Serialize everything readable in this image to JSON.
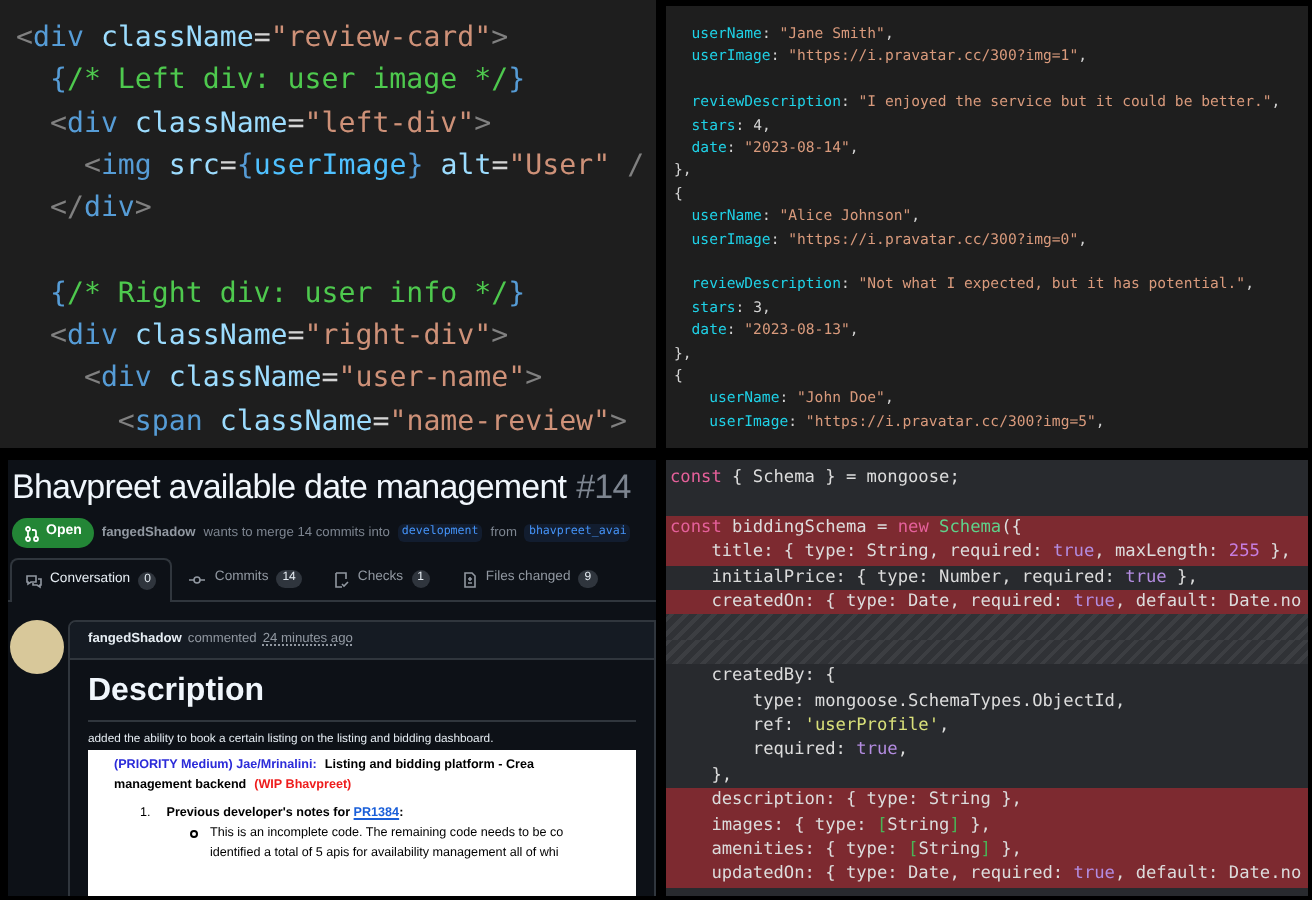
{
  "jsx_snippet": {
    "lines": [
      {
        "kind": "code",
        "tokens": [
          {
            "kind": "punct",
            "text": "<"
          },
          {
            "kind": "tag",
            "text": "div"
          },
          {
            "kind": "attr",
            "text": " className"
          },
          {
            "kind": "op",
            "text": "="
          },
          {
            "kind": "str",
            "text": "\"review-card\""
          },
          {
            "kind": "punct",
            "text": ">"
          }
        ]
      },
      {
        "kind": "code",
        "tokens": [
          {
            "kind": "brace",
            "text": "  {"
          },
          {
            "kind": "comment",
            "text": "/* Left div: user image */"
          },
          {
            "kind": "brace",
            "text": "}"
          }
        ]
      },
      {
        "kind": "code",
        "tokens": [
          {
            "kind": "punct",
            "text": "  <"
          },
          {
            "kind": "tag",
            "text": "div"
          },
          {
            "kind": "attr",
            "text": " className"
          },
          {
            "kind": "op",
            "text": "="
          },
          {
            "kind": "str",
            "text": "\"left-div\""
          },
          {
            "kind": "punct",
            "text": ">"
          }
        ]
      },
      {
        "kind": "code",
        "tokens": [
          {
            "kind": "punct",
            "text": "    <"
          },
          {
            "kind": "tag",
            "text": "img"
          },
          {
            "kind": "attr",
            "text": " src"
          },
          {
            "kind": "op",
            "text": "="
          },
          {
            "kind": "brace",
            "text": "{"
          },
          {
            "kind": "var",
            "text": "userImage"
          },
          {
            "kind": "brace",
            "text": "}"
          },
          {
            "kind": "attr",
            "text": " alt"
          },
          {
            "kind": "op",
            "text": "="
          },
          {
            "kind": "str",
            "text": "\"User\""
          },
          {
            "kind": "punct",
            "text": " /"
          }
        ]
      },
      {
        "kind": "code",
        "tokens": [
          {
            "kind": "punct",
            "text": "  </"
          },
          {
            "kind": "tag",
            "text": "div"
          },
          {
            "kind": "punct",
            "text": ">"
          }
        ]
      },
      {
        "kind": "blank"
      },
      {
        "kind": "code",
        "tokens": [
          {
            "kind": "brace",
            "text": "  {"
          },
          {
            "kind": "comment",
            "text": "/* Right div: user info */"
          },
          {
            "kind": "brace",
            "text": "}"
          }
        ]
      },
      {
        "kind": "code",
        "tokens": [
          {
            "kind": "punct",
            "text": "  <"
          },
          {
            "kind": "tag",
            "text": "div"
          },
          {
            "kind": "attr",
            "text": " className"
          },
          {
            "kind": "op",
            "text": "="
          },
          {
            "kind": "str",
            "text": "\"right-div\""
          },
          {
            "kind": "punct",
            "text": ">"
          }
        ]
      },
      {
        "kind": "code",
        "tokens": [
          {
            "kind": "punct",
            "text": "    <"
          },
          {
            "kind": "tag",
            "text": "div"
          },
          {
            "kind": "attr",
            "text": " className"
          },
          {
            "kind": "op",
            "text": "="
          },
          {
            "kind": "str",
            "text": "\"user-name\""
          },
          {
            "kind": "punct",
            "text": ">"
          }
        ]
      },
      {
        "kind": "code",
        "tokens": [
          {
            "kind": "punct",
            "text": "      <"
          },
          {
            "kind": "tag",
            "text": "span"
          },
          {
            "kind": "attr",
            "text": " className"
          },
          {
            "kind": "op",
            "text": "="
          },
          {
            "kind": "str",
            "text": "\"name-review\""
          },
          {
            "kind": "punct",
            "text": ">"
          }
        ]
      }
    ]
  },
  "reviews_data": {
    "lines": [
      {
        "kind": "code",
        "tokens": [
          {
            "kind": "key",
            "text": "  userName"
          },
          {
            "kind": "punct",
            "text": ": "
          },
          {
            "kind": "str",
            "text": "\"Jane Smith\""
          },
          {
            "kind": "punct",
            "text": ","
          }
        ]
      },
      {
        "kind": "code",
        "tokens": [
          {
            "kind": "key",
            "text": "  userImage"
          },
          {
            "kind": "punct",
            "text": ": "
          },
          {
            "kind": "str",
            "text": "\"https://i.pravatar.cc/300?img=1\""
          },
          {
            "kind": "punct",
            "text": ","
          }
        ]
      },
      {
        "kind": "blank"
      },
      {
        "kind": "code",
        "tokens": [
          {
            "kind": "key",
            "text": "  reviewDescription"
          },
          {
            "kind": "punct",
            "text": ": "
          },
          {
            "kind": "str",
            "text": "\"I enjoyed the service but it could be better.\""
          },
          {
            "kind": "punct",
            "text": ","
          }
        ]
      },
      {
        "kind": "code",
        "tokens": [
          {
            "kind": "key",
            "text": "  stars"
          },
          {
            "kind": "punct",
            "text": ": "
          },
          {
            "kind": "num",
            "text": "4"
          },
          {
            "kind": "punct",
            "text": ","
          }
        ]
      },
      {
        "kind": "code",
        "tokens": [
          {
            "kind": "key",
            "text": "  date"
          },
          {
            "kind": "punct",
            "text": ": "
          },
          {
            "kind": "str",
            "text": "\"2023-08-14\""
          },
          {
            "kind": "punct",
            "text": ","
          }
        ]
      },
      {
        "kind": "code",
        "tokens": [
          {
            "kind": "punct",
            "text": "},"
          }
        ]
      },
      {
        "kind": "code",
        "tokens": [
          {
            "kind": "punct",
            "text": "{"
          }
        ]
      },
      {
        "kind": "code",
        "tokens": [
          {
            "kind": "key",
            "text": "  userName"
          },
          {
            "kind": "punct",
            "text": ": "
          },
          {
            "kind": "str",
            "text": "\"Alice Johnson\""
          },
          {
            "kind": "punct",
            "text": ","
          }
        ]
      },
      {
        "kind": "code",
        "tokens": [
          {
            "kind": "key",
            "text": "  userImage"
          },
          {
            "kind": "punct",
            "text": ": "
          },
          {
            "kind": "str",
            "text": "\"https://i.pravatar.cc/300?img=0\""
          },
          {
            "kind": "punct",
            "text": ","
          }
        ]
      },
      {
        "kind": "blank"
      },
      {
        "kind": "code",
        "tokens": [
          {
            "kind": "key",
            "text": "  reviewDescription"
          },
          {
            "kind": "punct",
            "text": ": "
          },
          {
            "kind": "str",
            "text": "\"Not what I expected, but it has potential.\""
          },
          {
            "kind": "punct",
            "text": ","
          }
        ]
      },
      {
        "kind": "code",
        "tokens": [
          {
            "kind": "key",
            "text": "  stars"
          },
          {
            "kind": "punct",
            "text": ": "
          },
          {
            "kind": "num",
            "text": "3"
          },
          {
            "kind": "punct",
            "text": ","
          }
        ]
      },
      {
        "kind": "code",
        "tokens": [
          {
            "kind": "key",
            "text": "  date"
          },
          {
            "kind": "punct",
            "text": ": "
          },
          {
            "kind": "str",
            "text": "\"2023-08-13\""
          },
          {
            "kind": "punct",
            "text": ","
          }
        ]
      },
      {
        "kind": "code",
        "tokens": [
          {
            "kind": "punct",
            "text": "},"
          }
        ]
      },
      {
        "kind": "code",
        "tokens": [
          {
            "kind": "punct",
            "text": "{"
          }
        ]
      },
      {
        "kind": "code",
        "tokens": [
          {
            "kind": "key",
            "text": "    userName"
          },
          {
            "kind": "punct",
            "text": ": "
          },
          {
            "kind": "str",
            "text": "\"John Doe\""
          },
          {
            "kind": "punct",
            "text": ","
          }
        ]
      },
      {
        "kind": "code",
        "tokens": [
          {
            "kind": "key",
            "text": "    userImage"
          },
          {
            "kind": "punct",
            "text": ": "
          },
          {
            "kind": "str",
            "text": "\"https://i.pravatar.cc/300?img=5\""
          },
          {
            "kind": "punct",
            "text": ","
          }
        ]
      }
    ]
  },
  "pull_request": {
    "title": "Bhavpreet available date management",
    "number": "#14",
    "state": "Open",
    "meta": {
      "author": "fangedShadow",
      "text": "wants to merge 14 commits into",
      "base": "development",
      "from": "from",
      "head": "bhavpreet_avai"
    },
    "tabs": [
      {
        "kind": "conversation",
        "label": "Conversation",
        "count": "0",
        "selected": true
      },
      {
        "kind": "commits",
        "label": "Commits",
        "count": "14",
        "selected": false
      },
      {
        "kind": "checks",
        "label": "Checks",
        "count": "1",
        "selected": false
      },
      {
        "kind": "files",
        "label": "Files changed",
        "count": "9",
        "selected": false
      }
    ],
    "comment": {
      "author": "fangedShadow",
      "action": "commented",
      "time": "24 minutes ago",
      "heading": "Description",
      "body": "added the ability to book a certain listing on the listing and bidding dashboard.",
      "attachment": {
        "title": [
          {
            "kind": "priority",
            "text": "(PRIORITY Medium) Jae/Mrinalini:"
          },
          {
            "kind": "plain",
            "text": "Listing and bidding platform - Crea"
          }
        ],
        "subtitle": [
          {
            "kind": "plain",
            "text": "management backend"
          },
          {
            "kind": "wip",
            "text": "(WIP Bhavpreet)"
          }
        ],
        "item": {
          "marker": "1.",
          "text": "Previous developer's notes for",
          "link": "PR1384",
          "suffix": ":",
          "bullet_lines": [
            "This is an incomplete code. The remaining code needs to be co",
            "identified a total of 5 apis for availability management all of whi"
          ]
        }
      }
    }
  },
  "schema_diff": {
    "lines": [
      {
        "kind": "code",
        "removed": false,
        "tokens": [
          {
            "kind": "kw",
            "text": "const"
          },
          {
            "kind": "plain",
            "text": " { Schema } = mongoose;"
          }
        ]
      },
      {
        "kind": "blank"
      },
      {
        "kind": "code",
        "removed": true,
        "tokens": [
          {
            "kind": "kw",
            "text": "const"
          },
          {
            "kind": "plain",
            "text": " biddingSchema = "
          },
          {
            "kind": "kw",
            "text": "new"
          },
          {
            "kind": "cls",
            "text": " Schema"
          },
          {
            "kind": "plain",
            "text": "({"
          }
        ]
      },
      {
        "kind": "code",
        "removed": true,
        "tokens": [
          {
            "kind": "plain",
            "text": "    title: { type: String, required: "
          },
          {
            "kind": "bool",
            "text": "true"
          },
          {
            "kind": "plain",
            "text": ", maxLength: "
          },
          {
            "kind": "num",
            "text": "255"
          },
          {
            "kind": "plain",
            "text": " },"
          }
        ]
      },
      {
        "kind": "code",
        "removed": false,
        "tokens": [
          {
            "kind": "plain",
            "text": "    initialPrice: { type: Number, required: "
          },
          {
            "kind": "bool",
            "text": "true"
          },
          {
            "kind": "plain",
            "text": " },"
          }
        ]
      },
      {
        "kind": "code",
        "removed": true,
        "tokens": [
          {
            "kind": "plain",
            "text": "    createdOn: { type: Date, required: "
          },
          {
            "kind": "bool",
            "text": "true"
          },
          {
            "kind": "plain",
            "text": ", default: Date.no"
          }
        ]
      },
      {
        "kind": "filler"
      },
      {
        "kind": "filler"
      },
      {
        "kind": "code",
        "removed": false,
        "tokens": [
          {
            "kind": "plain",
            "text": "    createdBy: {"
          }
        ]
      },
      {
        "kind": "code",
        "removed": false,
        "tokens": [
          {
            "kind": "plain",
            "text": "        type: mongoose.SchemaTypes.ObjectId,"
          }
        ]
      },
      {
        "kind": "code",
        "removed": false,
        "tokens": [
          {
            "kind": "plain",
            "text": "        ref: "
          },
          {
            "kind": "str",
            "text": "'userProfile'"
          },
          {
            "kind": "plain",
            "text": ","
          }
        ]
      },
      {
        "kind": "code",
        "removed": false,
        "tokens": [
          {
            "kind": "plain",
            "text": "        required: "
          },
          {
            "kind": "bool",
            "text": "true"
          },
          {
            "kind": "plain",
            "text": ","
          }
        ]
      },
      {
        "kind": "code",
        "removed": false,
        "tokens": [
          {
            "kind": "plain",
            "text": "    },"
          }
        ]
      },
      {
        "kind": "code",
        "removed": true,
        "tokens": [
          {
            "kind": "plain",
            "text": "    description: { type: String },"
          }
        ]
      },
      {
        "kind": "code",
        "removed": true,
        "tokens": [
          {
            "kind": "plain",
            "text": "    images: { type: "
          },
          {
            "kind": "bracket",
            "text": "["
          },
          {
            "kind": "plain",
            "text": "String"
          },
          {
            "kind": "bracket",
            "text": "]"
          },
          {
            "kind": "plain",
            "text": " },"
          }
        ]
      },
      {
        "kind": "code",
        "removed": true,
        "tokens": [
          {
            "kind": "plain",
            "text": "    amenities: { type: "
          },
          {
            "kind": "bracket",
            "text": "["
          },
          {
            "kind": "plain",
            "text": "String"
          },
          {
            "kind": "bracket",
            "text": "]"
          },
          {
            "kind": "plain",
            "text": " },"
          }
        ]
      },
      {
        "kind": "code",
        "removed": true,
        "tokens": [
          {
            "kind": "plain",
            "text": "    updatedOn: { type: Date, required: "
          },
          {
            "kind": "bool",
            "text": "true"
          },
          {
            "kind": "plain",
            "text": ", default: Date.no"
          }
        ]
      }
    ]
  }
}
